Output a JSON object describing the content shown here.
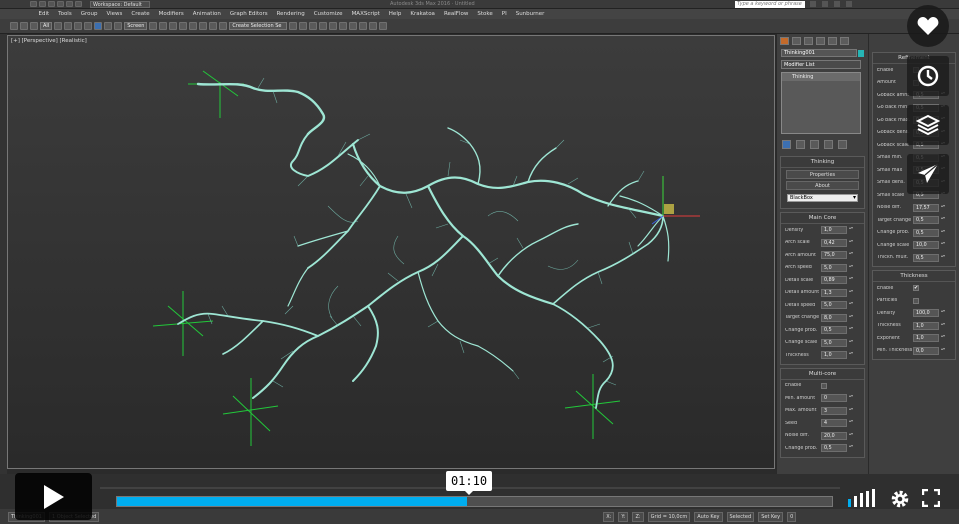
{
  "titlebar": {
    "workspace": "Workspace: Default",
    "title": "Autodesk 3ds Max 2016 · Untitled",
    "search_placeholder": "Type a keyword or phrase"
  },
  "menu": [
    "Edit",
    "Tools",
    "Group",
    "Views",
    "Create",
    "Modifiers",
    "Animation",
    "Graph Editors",
    "Rendering",
    "Customize",
    "MAXScript",
    "Help",
    "Krakatoa",
    "RealFlow",
    "Stoke",
    "PI",
    "Sunburner"
  ],
  "toolbar": {
    "filter": "All",
    "coord": "Screen",
    "selection_set": "Create Selection Se"
  },
  "viewport": {
    "label": "[+] [Perspective] [Realistic]"
  },
  "command_panel": {
    "object_name": "Thinking001",
    "object_color": "#26b5b5",
    "modifier_list": "Modifier List",
    "stack_item": "Thinking",
    "rollout_title": "Thinking",
    "btn_properties": "Properties",
    "btn_about": "About",
    "mode_dropdown": "BlackBox",
    "main_core": {
      "title": "Main Core",
      "params": [
        {
          "label": "Density",
          "value": "1,0"
        },
        {
          "label": "Arch scale",
          "value": "0,42"
        },
        {
          "label": "Arch amount",
          "value": "75,0"
        },
        {
          "label": "Arch speed",
          "value": "5,0"
        },
        {
          "label": "Detail scale",
          "value": "0,89"
        },
        {
          "label": "Detail amount",
          "value": "1,3"
        },
        {
          "label": "Detail speed",
          "value": "5,0"
        },
        {
          "label": "Target change",
          "value": "8,0"
        },
        {
          "label": "Change prob.",
          "value": "0,5"
        },
        {
          "label": "Change scale",
          "value": "5,0"
        },
        {
          "label": "Thickness",
          "value": "1,0"
        }
      ]
    },
    "multi_core": {
      "title": "Multi-core",
      "enable_label": "Enable",
      "params": [
        {
          "label": "Min. amount",
          "value": "0"
        },
        {
          "label": "Max. amount",
          "value": "3"
        },
        {
          "label": "Seed",
          "value": "4"
        },
        {
          "label": "Noise diff.",
          "value": "20,0"
        },
        {
          "label": "Change prob.",
          "value": "0,5"
        }
      ]
    }
  },
  "side_panel": {
    "section_title": "Refinement",
    "params": [
      {
        "label": "Enable",
        "value": ""
      },
      {
        "label": "Amount",
        "value": ""
      },
      {
        "label": "Goback amnt.",
        "value": "0,5"
      },
      {
        "label": "Go back min.",
        "value": "0,5"
      },
      {
        "label": "Go back max.",
        "value": "0,5"
      },
      {
        "label": "Goback dens.",
        "value": "0,5"
      },
      {
        "label": "Goback scale",
        "value": "0,5"
      },
      {
        "label": "Small min.",
        "value": "0,5"
      },
      {
        "label": "Small max",
        "value": "0,5"
      },
      {
        "label": "Small dens.",
        "value": "0,5"
      },
      {
        "label": "Small scale",
        "value": "0,5"
      },
      {
        "label": "Noise diff.",
        "value": "17,57"
      },
      {
        "label": "Target change",
        "value": "0,5"
      },
      {
        "label": "Change prob.",
        "value": "0,5"
      },
      {
        "label": "Change scale",
        "value": "10,0"
      },
      {
        "label": "Thickn. mult.",
        "value": "0,5"
      }
    ],
    "thickness": {
      "title": "Thickness",
      "params": [
        {
          "label": "Enable",
          "value": "✔"
        },
        {
          "label": "Particles",
          "value": ""
        },
        {
          "label": "Density",
          "value": "100,0"
        },
        {
          "label": "Thickness",
          "value": "1,0"
        },
        {
          "label": "Exponent",
          "value": "1,0"
        },
        {
          "label": "Min. Thickness",
          "value": "0,0"
        }
      ]
    }
  },
  "status": {
    "object": "Thinking001",
    "selected": "1 Object Selected",
    "x_label": "X:",
    "y_label": "Y:",
    "z_label": "Z:",
    "grid": "Grid = 10,0cm",
    "autokey": "Auto Key",
    "set_key": "Set Key",
    "selected_dd": "Selected",
    "frame": "0"
  },
  "video_player": {
    "time": "01:10",
    "progress": 0.49
  }
}
